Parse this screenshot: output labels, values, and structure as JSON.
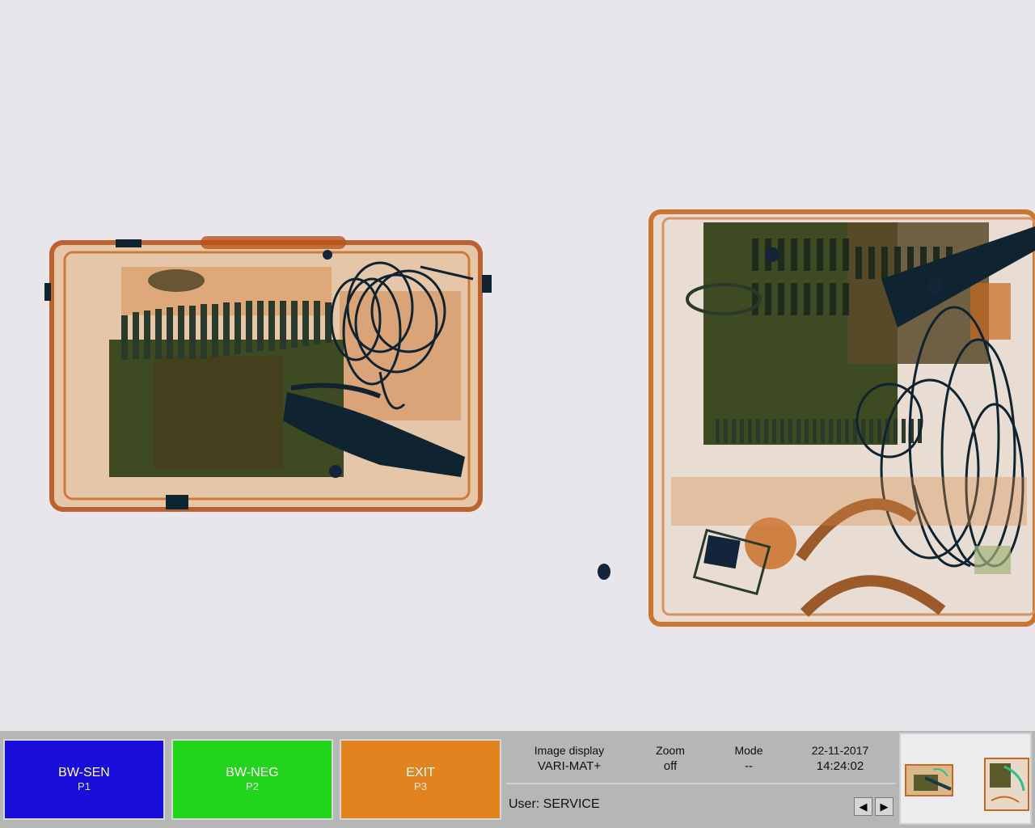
{
  "function_keys": [
    {
      "label": "BW-SEN",
      "sub": "P1",
      "color": "#1a0edb"
    },
    {
      "label": "BW-NEG",
      "sub": "P2",
      "color": "#22d41b"
    },
    {
      "label": "EXIT",
      "sub": "P3",
      "color": "#e1831e"
    }
  ],
  "status": {
    "image_display": {
      "label": "Image display",
      "value": "VARI-MAT+"
    },
    "zoom": {
      "label": "Zoom",
      "value": "off"
    },
    "mode": {
      "label": "Mode",
      "value": "--"
    },
    "date": "22-11-2017",
    "time": "14:24:02",
    "user": "User: SERVICE"
  },
  "nav": {
    "prev_icon": "triangle-left-icon",
    "next_icon": "triangle-right-icon"
  },
  "colors": {
    "background": "#e8e6ea",
    "organic": "#c8691f",
    "inorganic": "#3e4a22",
    "metal": "#0f2430",
    "bar": "#b6b6b6"
  }
}
